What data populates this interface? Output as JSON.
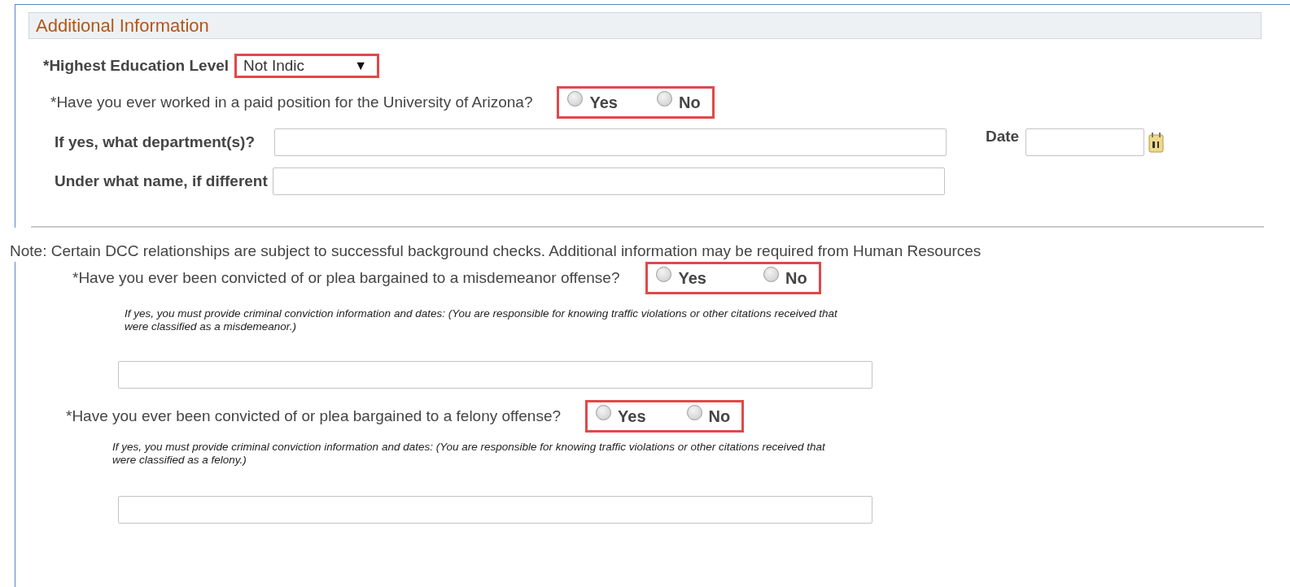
{
  "section": {
    "title": "Additional Information"
  },
  "education": {
    "label": "*Highest Education Level",
    "value": "Not Indic",
    "arrow": "▼",
    "highlighted": true
  },
  "worked": {
    "question": "*Have you ever worked in a paid position for the University of Arizona?",
    "highlighted": true,
    "options": [
      {
        "label": "Yes",
        "selected": false
      },
      {
        "label": "No",
        "selected": false
      }
    ]
  },
  "department": {
    "label": "If yes, what department(s)?"
  },
  "date": {
    "label": "Date"
  },
  "other_name": {
    "label": "Under what name, if different"
  },
  "note": "Note: Certain DCC relationships are subject to successful background checks. Additional information may be required from Human Resources",
  "background_questions": [
    {
      "question": "*Have you ever been convicted of or plea bargained to a misdemeanor offense?",
      "highlighted": true,
      "options": [
        {
          "label": "Yes",
          "selected": false
        },
        {
          "label": "No",
          "selected": false
        }
      ],
      "hint": "If yes, you must provide criminal conviction information and dates: (You are responsible for knowing traffic violations or other citations received that were classified as a misdemeanor.)"
    },
    {
      "question": "*Have you ever been convicted of or plea bargained to a felony offense?",
      "highlighted": true,
      "options": [
        {
          "label": "Yes",
          "selected": false
        },
        {
          "label": "No",
          "selected": false
        }
      ],
      "hint": "If yes, you must provide criminal conviction information and dates: (You are responsible for knowing traffic violations or other citations received that were classified as a felony.)"
    }
  ]
}
